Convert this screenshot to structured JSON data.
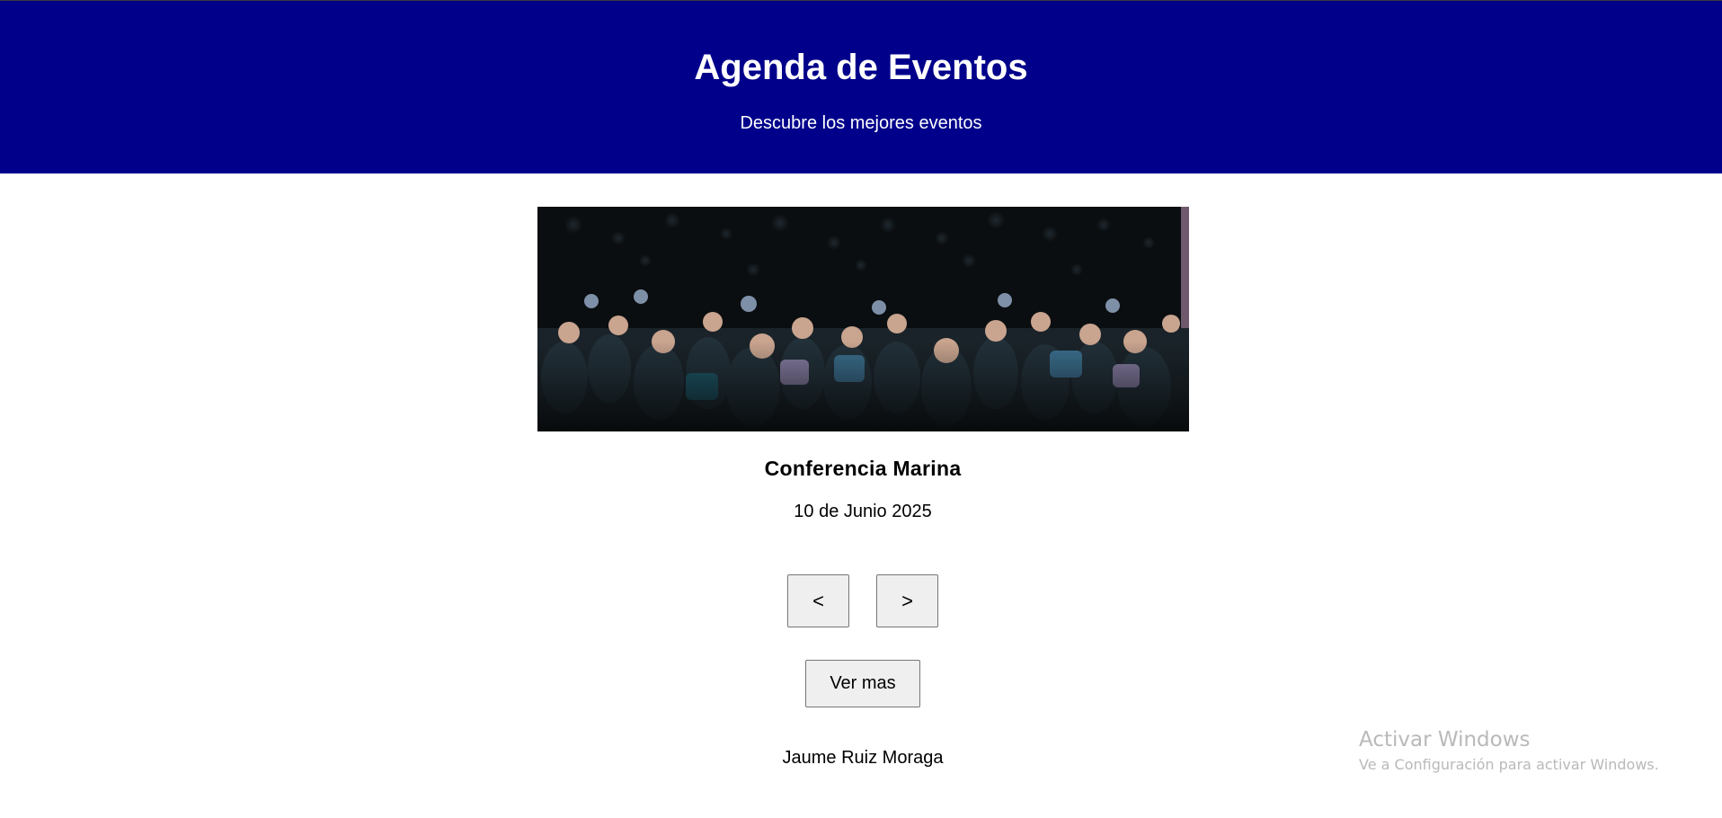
{
  "header": {
    "title": "Agenda de Eventos",
    "subtitle": "Descubre los mejores eventos",
    "background_color": "#00008b"
  },
  "event": {
    "image_alt": "audience-photo",
    "title": "Conferencia Marina",
    "date": "10 de Junio 2025"
  },
  "controls": {
    "prev_label": "<",
    "next_label": ">",
    "more_label": "Ver mas"
  },
  "footer": {
    "author": "Jaume Ruiz Moraga"
  },
  "watermark": {
    "title": "Activar Windows",
    "subtitle": "Ve a Configuración para activar Windows."
  }
}
